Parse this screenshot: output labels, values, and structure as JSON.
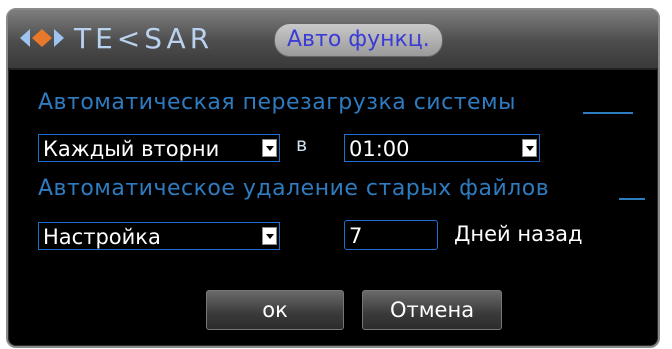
{
  "window": {
    "logo_text": "TE<SAR",
    "title": "Авто функц."
  },
  "reboot": {
    "section_label": "Автоматическая перезагрузка системы",
    "day_select": "Каждый вторни",
    "at_label": "в",
    "time_select": "01:00"
  },
  "delete": {
    "section_label": "Автоматическое удаление старых файлов",
    "mode_select": "Настройка",
    "days_value": "7",
    "days_suffix": "Дней назад"
  },
  "buttons": {
    "ok": "ок",
    "cancel": "Отмена"
  },
  "colors": {
    "accent_blue": "#2f7bbf",
    "field_border": "#1f6fd0",
    "title_text": "#3b3bd6"
  },
  "icons": {
    "logo": "diamond-arrows-icon",
    "dropdown": "chevron-down-icon"
  }
}
